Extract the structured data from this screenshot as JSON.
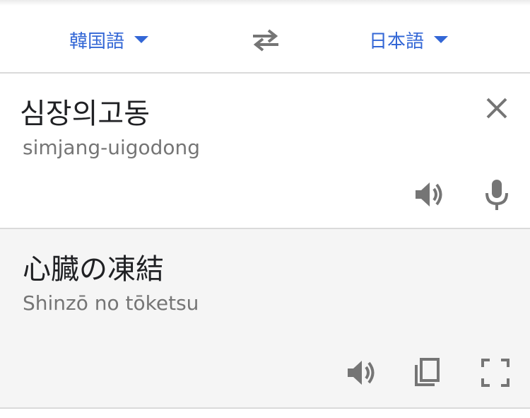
{
  "languages": {
    "source": "韓国語",
    "target": "日本語"
  },
  "source": {
    "text": "심장의고동",
    "transliteration": "simjang-uigodong"
  },
  "result": {
    "text": "心臓の凍結",
    "transliteration": "Shinzō no tōketsu"
  },
  "icons": {
    "swap": "swap-arrows-icon",
    "clear": "close-icon",
    "source_speak": "speaker-icon",
    "mic": "microphone-icon",
    "result_speak": "speaker-icon",
    "copy": "copy-icon",
    "fullscreen": "fullscreen-icon"
  },
  "colors": {
    "accent": "#3367d6",
    "icon": "#757575",
    "result_background": "#f5f5f5"
  }
}
